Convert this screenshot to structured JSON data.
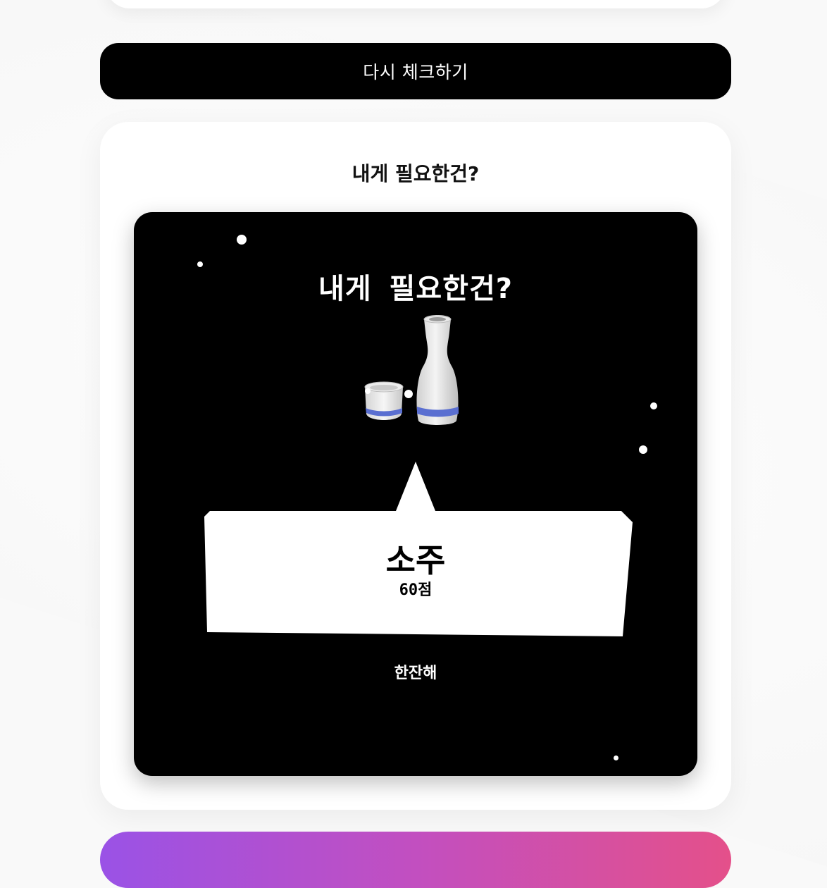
{
  "retry_button": {
    "label": "다시 체크하기"
  },
  "result_card": {
    "title": "내게 필요한건?",
    "share_image": {
      "title": "내게  필요한건?",
      "icon": "sake-bottle-and-cup-icon",
      "result_name": "소주",
      "result_score": "60점",
      "caption": "한잔해"
    }
  },
  "colors": {
    "button_bg": "#000000",
    "image_bg": "#000000",
    "gradient_start": "#9a52e6",
    "gradient_end": "#e4508a"
  }
}
